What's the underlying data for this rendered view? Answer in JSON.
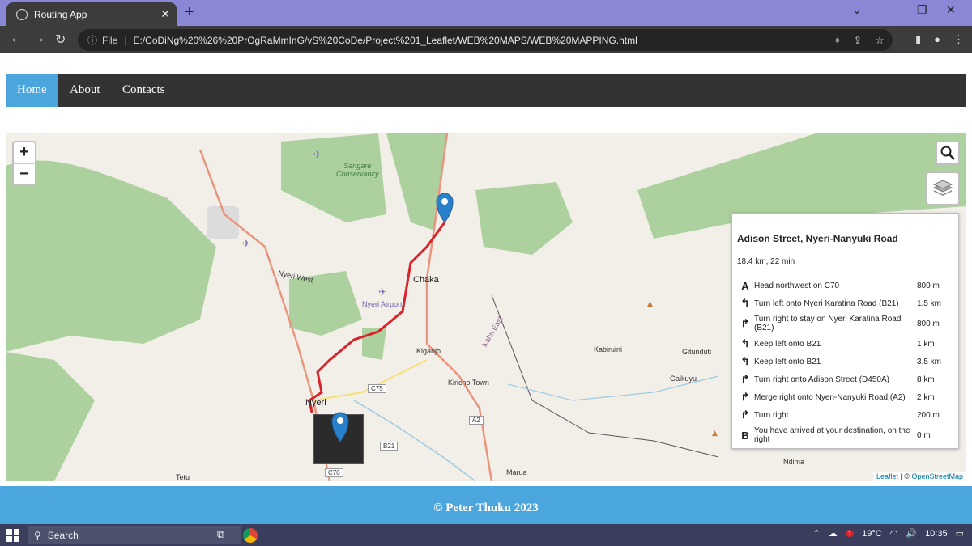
{
  "browser": {
    "tab_title": "Routing App",
    "tab_close": "✕",
    "new_tab": "+",
    "url_scheme": "File",
    "url": "E:/CoDiNg%20%26%20PrOgRaMmInG/vS%20CoDe/Project%201_Leaflet/WEB%20MAPS/WEB%20MAPPING.html"
  },
  "nav": {
    "items": [
      {
        "label": "Home"
      },
      {
        "label": "About"
      },
      {
        "label": "Contacts"
      }
    ]
  },
  "map": {
    "zoom_in": "+",
    "zoom_out": "−",
    "labels": {
      "sangare": "Sangare\nConservancy",
      "chaka": "Chaka",
      "nyeri_west": "Nyeri West",
      "nyeri_airport": "Nyeri Airport",
      "kiganjo": "Kiganjo",
      "kiricho_town": "Kiricho Town",
      "kabiruini": "Kabiruini",
      "gitunduti": "Gitunduti",
      "gaikuyu": "Gaikuyu",
      "ndima": "Ndima",
      "marua": "Marua",
      "nyeri": "Nyeri",
      "tetu": "Tetu",
      "kahn_east": "Kahn East"
    },
    "road_shields": {
      "c75": "C75",
      "a2": "A2",
      "b21": "B21",
      "c70": "C70"
    },
    "attribution": {
      "leaflet": "Leaflet",
      "sep": " | © ",
      "osm": "OpenStreetMap"
    }
  },
  "route_panel": {
    "title": "Adison Street, Nyeri-Nanyuki Road",
    "summary": "18.4 km, 22 min",
    "steps": [
      {
        "icon": "A",
        "text": "Head northwest on C70",
        "distance": "800 m"
      },
      {
        "icon": "↰",
        "text": "Turn left onto Nyeri Karatina Road (B21)",
        "distance": "1.5 km"
      },
      {
        "icon": "↱",
        "text": "Turn right to stay on Nyeri Karatina Road (B21)",
        "distance": "800 m"
      },
      {
        "icon": "↰",
        "text": "Keep left onto B21",
        "distance": "1 km"
      },
      {
        "icon": "↰",
        "text": "Keep left onto B21",
        "distance": "3.5 km"
      },
      {
        "icon": "↱",
        "text": "Turn right onto Adison Street (D450A)",
        "distance": "8 km"
      },
      {
        "icon": "↱",
        "text": "Merge right onto Nyeri-Nanyuki Road (A2)",
        "distance": "2 km"
      },
      {
        "icon": "↱",
        "text": "Turn right",
        "distance": "200 m"
      },
      {
        "icon": "B",
        "text": "You have arrived at your destination, on the right",
        "distance": "0 m"
      }
    ]
  },
  "footer": {
    "text": "© Peter Thuku 2023"
  },
  "taskbar": {
    "search_label": "Search",
    "weather_badge": "1",
    "temperature": "19°C",
    "time": "10:35"
  },
  "colors": {
    "nav_active": "#4ca6de",
    "route": "#d8232a",
    "marker": "#2a81cb"
  }
}
